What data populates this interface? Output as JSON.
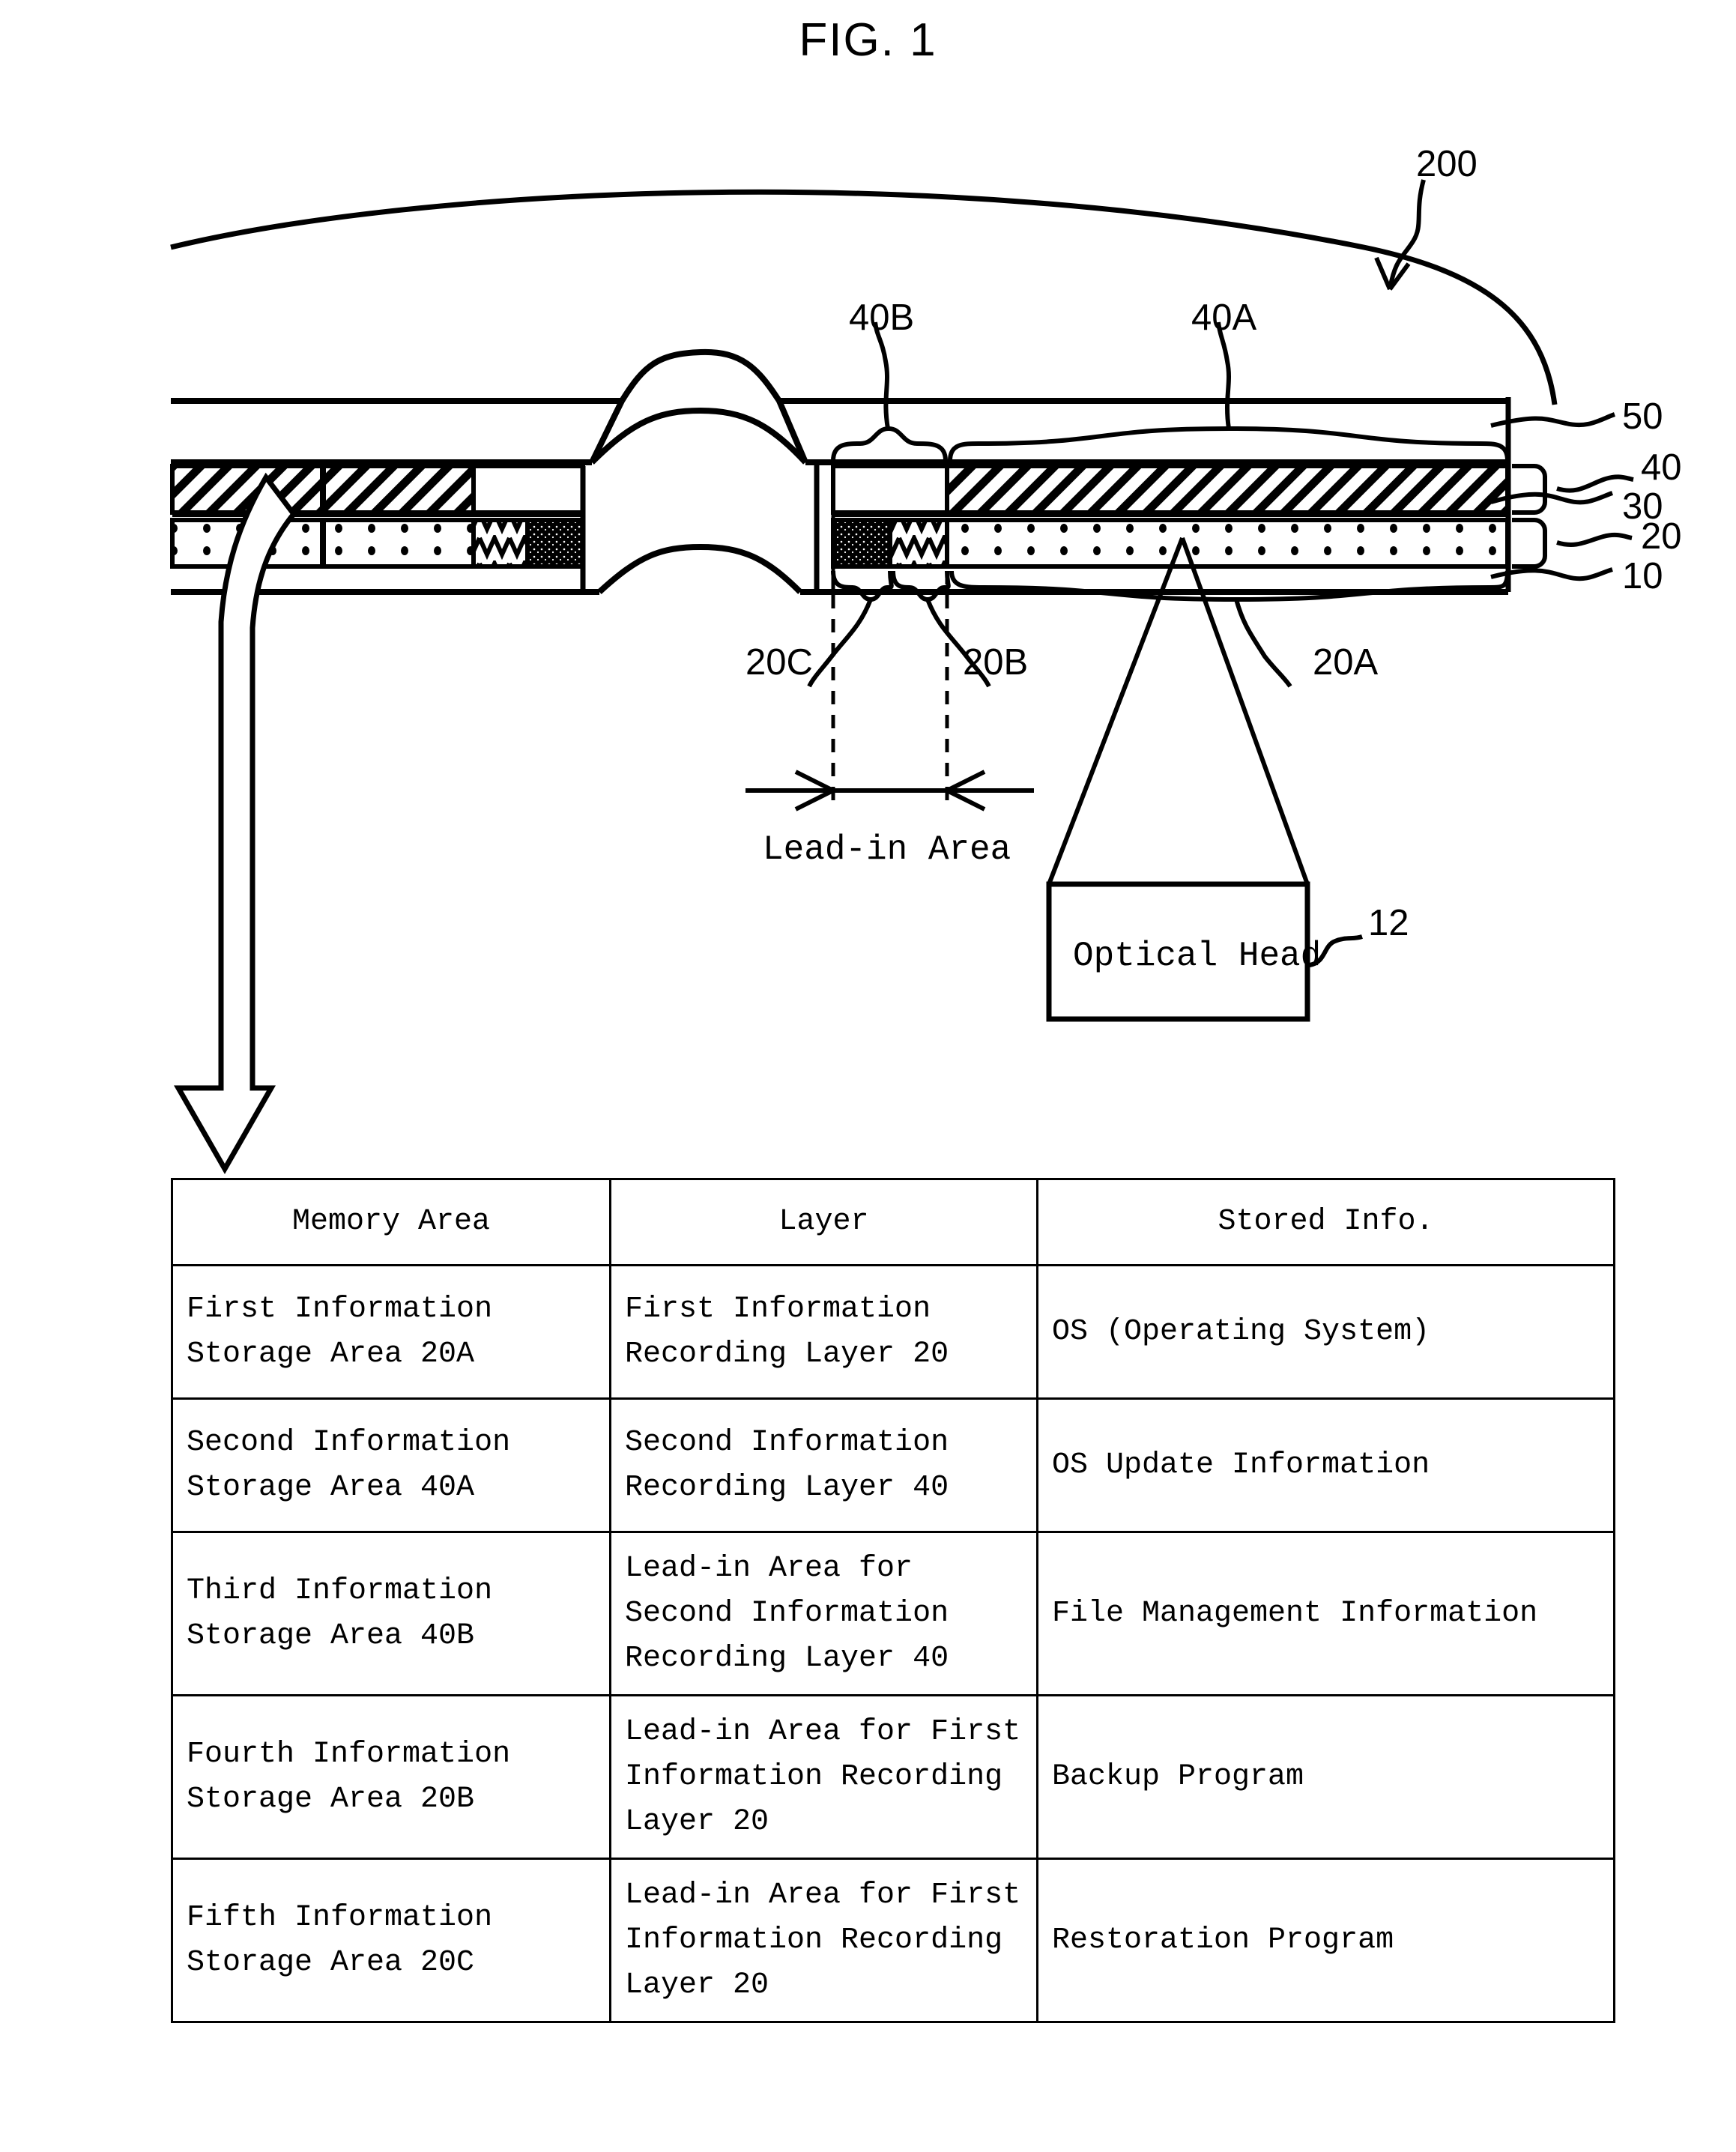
{
  "figure": {
    "title": "FIG. 1",
    "device_ref": "200",
    "optical_head_label": "Optical Head",
    "optical_head_ref": "12",
    "lead_in_label": "Lead-in Area",
    "layer_refs": [
      "50",
      "40",
      "30",
      "20",
      "10"
    ],
    "region_labels": {
      "layer40_upper_left": "40B",
      "layer40_upper_right": "40A",
      "layer20_lower_left": "20C",
      "layer20_lower_mid": "20B",
      "layer20_lower_right": "20A"
    }
  },
  "table": {
    "headers": [
      "Memory Area",
      "Layer",
      "Stored Info."
    ],
    "rows": [
      {
        "area": [
          "First Information",
          "Storage Area 20A"
        ],
        "layer": [
          "First Information",
          "Recording Layer 20"
        ],
        "stored": [
          "OS (Operating System)"
        ]
      },
      {
        "area": [
          "Second Information",
          "Storage Area 40A"
        ],
        "layer": [
          "Second Information",
          "Recording Layer 40"
        ],
        "stored": [
          "OS Update Information"
        ]
      },
      {
        "area": [
          "Third Information",
          "Storage Area 40B"
        ],
        "layer": [
          "Lead-in Area for",
          "Second Information",
          "Recording Layer 40"
        ],
        "stored": [
          "File Management Information"
        ]
      },
      {
        "area": [
          "Fourth Information",
          "Storage Area 20B"
        ],
        "layer": [
          "Lead-in Area for First",
          "Information Recording",
          "Layer 20"
        ],
        "stored": [
          "Backup Program"
        ]
      },
      {
        "area": [
          "Fifth Information",
          "Storage Area 20C"
        ],
        "layer": [
          "Lead-in Area for First",
          "Information Recording",
          "Layer 20"
        ],
        "stored": [
          "Restoration Program"
        ]
      }
    ]
  },
  "colors": {
    "ink": "#000000",
    "paper": "#ffffff"
  }
}
